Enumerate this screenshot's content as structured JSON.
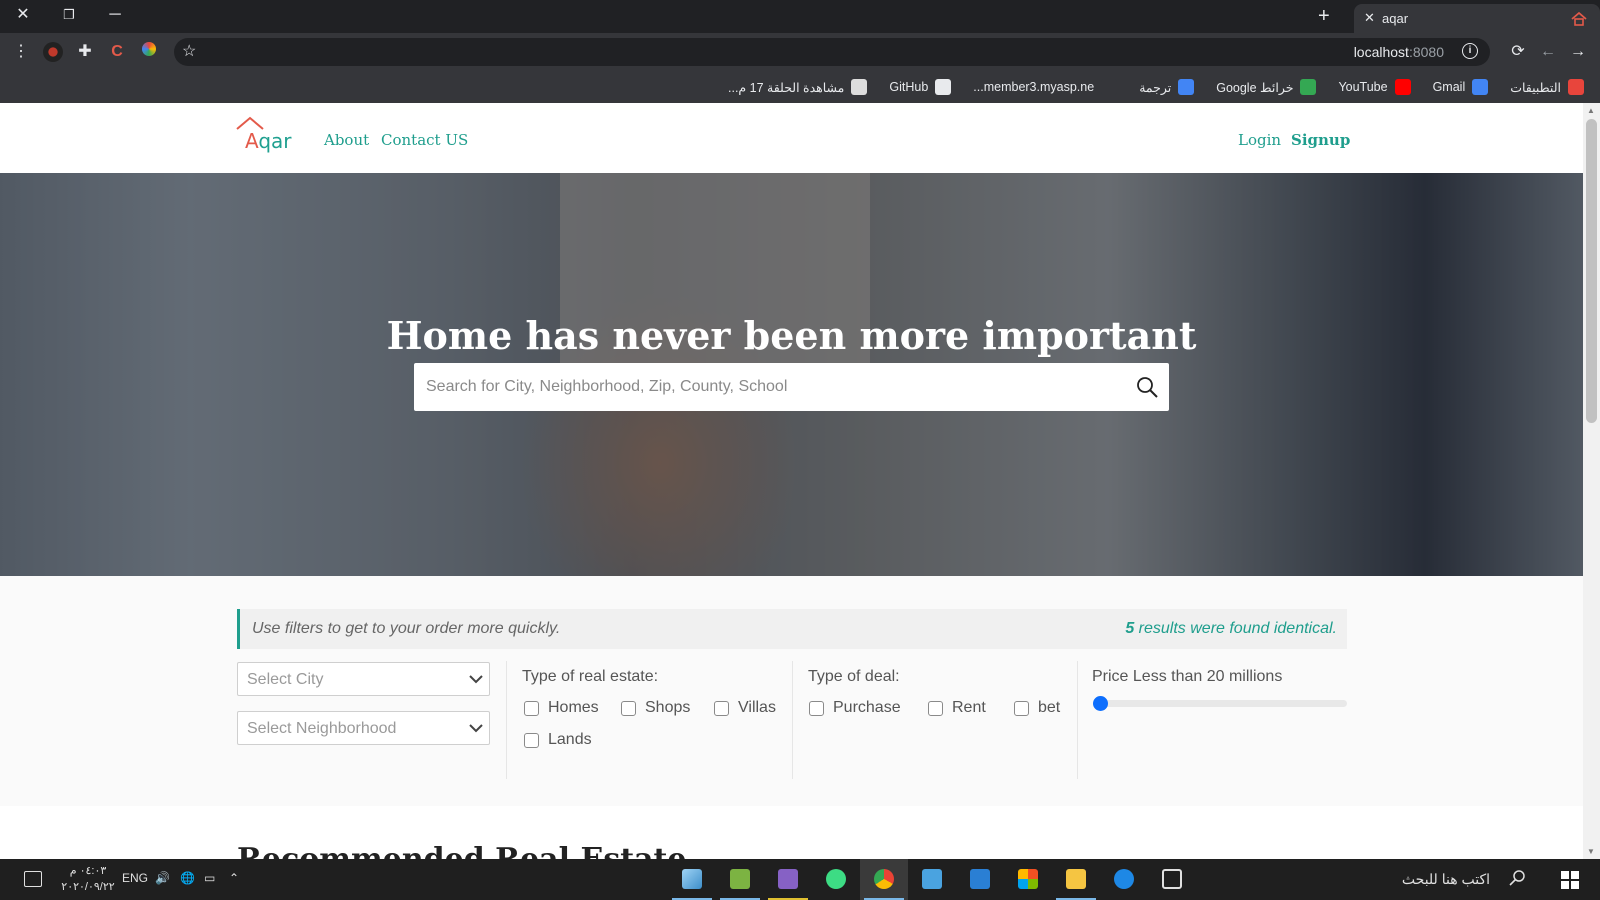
{
  "browser": {
    "tab_title": "aqar",
    "url_host": "localhost",
    "url_port": ":8080",
    "bookmarks": [
      {
        "label": "التطبيقات",
        "icon": "apps-grid-icon",
        "color": "#e8453c"
      },
      {
        "label": "Gmail",
        "icon": "google-icon",
        "color": "#4285f4"
      },
      {
        "label": "YouTube",
        "icon": "youtube-icon",
        "color": "#ff0000"
      },
      {
        "label": "خرائط Google",
        "icon": "maps-icon",
        "color": "#34a853"
      },
      {
        "label": "ترجمة",
        "icon": "translate-icon",
        "color": "#4285f4"
      },
      {
        "label": "member3.myasp.ne...",
        "icon": "m-icon",
        "color": "#35363a"
      },
      {
        "label": "GitHub",
        "icon": "github-icon",
        "color": "#e8eaed"
      },
      {
        "label": "مشاهدة الحلقة 17 م...",
        "icon": "video-icon",
        "color": "#dddddd"
      }
    ]
  },
  "nav": {
    "logo_a": "A",
    "logo_rest": "qar",
    "about": "About",
    "contact": "Contact US",
    "login": "Login",
    "signup": "Signup"
  },
  "hero": {
    "title": "Home has never been more important",
    "search_placeholder": "Search for City, Neighborhood, Zip, County, School"
  },
  "filters": {
    "info_text": "Use filters to get to your order more quickly.",
    "results_count": "5",
    "results_text": " results were found identical.",
    "city_placeholder": "Select City",
    "neighborhood_placeholder": "Select Neighborhood",
    "real_estate_label": "Type of real estate:",
    "real_estate_options": [
      "Homes",
      "Shops",
      "Villas",
      "Lands"
    ],
    "deal_label": "Type of deal:",
    "deal_options": [
      "Purchase",
      "Rent",
      "bet"
    ],
    "price_label": "Price Less than 20 millions",
    "price_slider_fraction": 0,
    "accent_color": "#1f9e8d"
  },
  "next_section": {
    "title": "Recommended Real Estate"
  },
  "taskbar": {
    "search_text": "اكتب هنا للبحث",
    "language": "ENG",
    "time": "٠٤:٠٣ م",
    "date": "٢٠٢٠/٠٩/٢٢"
  }
}
